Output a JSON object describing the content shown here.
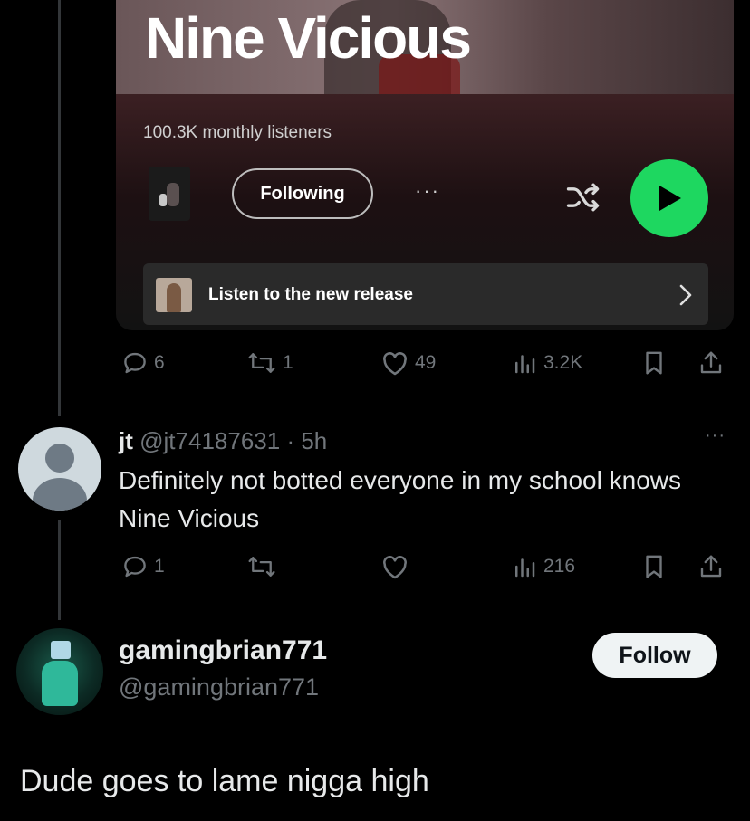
{
  "spotify_card": {
    "artist_name": "Nine Vicious",
    "monthly_listeners": "100.3K monthly listeners",
    "following_label": "Following",
    "more_label": "···",
    "release_label": "Listen to the new release",
    "play_color": "#1ed760"
  },
  "quoted_post_actions": {
    "replies": "6",
    "reposts": "1",
    "likes": "49",
    "views": "3.2K"
  },
  "reply": {
    "display_name": "jt",
    "handle": "@jt74187631",
    "time": "· 5h",
    "more_label": "···",
    "text": "Definitely not botted everyone in my school knows Nine Vicious",
    "actions": {
      "replies": "1",
      "views": "216"
    }
  },
  "bottom_post": {
    "display_name": "gamingbrian771",
    "handle": "@gamingbrian771",
    "follow_label": "Follow",
    "text": "Dude goes to lame nigga high"
  },
  "icons": [
    "reply-icon",
    "repost-icon",
    "like-icon",
    "views-icon",
    "bookmark-icon",
    "share-icon",
    "shuffle-icon",
    "play-icon",
    "chevron-right-icon"
  ]
}
